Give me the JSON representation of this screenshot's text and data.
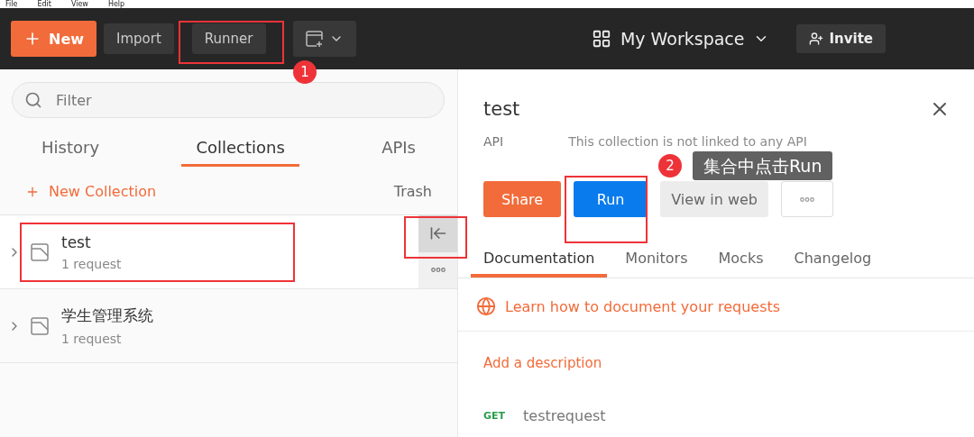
{
  "menu": [
    "File",
    "Edit",
    "View",
    "Help"
  ],
  "toolbar": {
    "new_button": "New",
    "import_button": "Import",
    "runner_button": "Runner",
    "workspace": "My Workspace",
    "invite_button": "Invite"
  },
  "sidebar": {
    "search": {
      "placeholder": "Filter"
    },
    "tabs": [
      {
        "label": "History",
        "selected": false
      },
      {
        "label": "Collections",
        "selected": true
      },
      {
        "label": "APIs",
        "selected": false
      }
    ],
    "new_collection": "New Collection",
    "trash": "Trash",
    "collections": [
      {
        "name": "test",
        "count": "1 request",
        "hovered": true
      },
      {
        "name": "学生管理系统",
        "count": "1 request",
        "hovered": false
      }
    ]
  },
  "detail": {
    "title": "test",
    "api_label": "API",
    "api_text": "This collection is not linked to any API",
    "buttons": [
      {
        "kind": "share",
        "label": "Share"
      },
      {
        "kind": "primary",
        "label": "Run"
      },
      {
        "kind": "secondary",
        "label": "View in web"
      },
      {
        "kind": "more"
      }
    ],
    "tabs": [
      {
        "label": "Documentation",
        "selected": true
      },
      {
        "label": "Monitors",
        "selected": false
      },
      {
        "label": "Mocks",
        "selected": false
      },
      {
        "label": "Changelog",
        "selected": false
      }
    ],
    "learn_link": "Learn how to document your requests",
    "add_description": "Add a description",
    "requests": [
      {
        "method": "GET",
        "name": "testrequest"
      }
    ]
  },
  "annotations": [
    {
      "number": "1"
    },
    {
      "number": "2",
      "text": "集合中点击Run"
    }
  ]
}
